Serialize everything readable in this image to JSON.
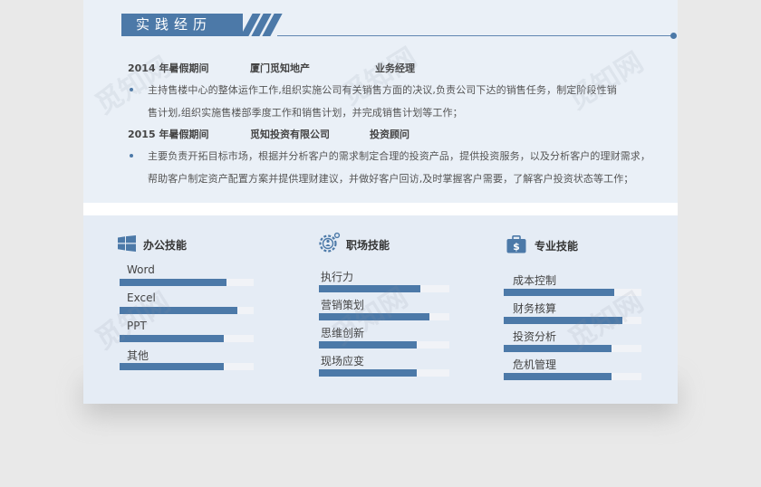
{
  "section": {
    "title": "实践经历"
  },
  "experience": [
    {
      "period": "2014 年暑假期间",
      "company": "厦门觅知地产",
      "role": "业务经理",
      "lines": [
        "主持售楼中心的整体运作工作,组织实施公司有关销售方面的决议,负责公司下达的销售任务，制定阶段性销",
        "售计划,组织实施售楼部季度工作和销售计划，并完成销售计划等工作；"
      ]
    },
    {
      "period": "2015 年暑假期间",
      "company": "觅知投资有限公司",
      "role": "投资顾问",
      "lines": [
        "主要负责开拓目标市场，根据并分析客户的需求制定合理的投资产品，提供投资服务，以及分析客户的理财需求，",
        "帮助客户制定资产配置方案并提供理财建议，并做好客户回访,及时掌握客户需要，了解客户投资状态等工作；"
      ]
    }
  ],
  "skills": {
    "office": {
      "title": "办公技能",
      "icon": "windows-icon",
      "items": [
        {
          "label": "Word",
          "level": 0.8
        },
        {
          "label": "Excel",
          "level": 0.88
        },
        {
          "label": "PPT",
          "level": 0.78
        },
        {
          "label": "其他",
          "level": 0.78
        }
      ]
    },
    "workplace": {
      "title": "职场技能",
      "icon": "gear-person-icon",
      "items": [
        {
          "label": "执行力",
          "level": 0.78
        },
        {
          "label": "营销策划",
          "level": 0.85
        },
        {
          "label": "思维创新",
          "level": 0.75
        },
        {
          "label": "现场应变",
          "level": 0.75
        }
      ]
    },
    "professional": {
      "title": "专业技能",
      "icon": "briefcase-dollar-icon",
      "items": [
        {
          "label": "成本控制",
          "level": 0.8
        },
        {
          "label": "财务核算",
          "level": 0.86
        },
        {
          "label": "投资分析",
          "level": 0.78
        },
        {
          "label": "危机管理",
          "level": 0.78
        }
      ]
    }
  },
  "watermark": "觅知网",
  "colors": {
    "accent": "#4c79a8",
    "track": "#f1f3f7"
  }
}
